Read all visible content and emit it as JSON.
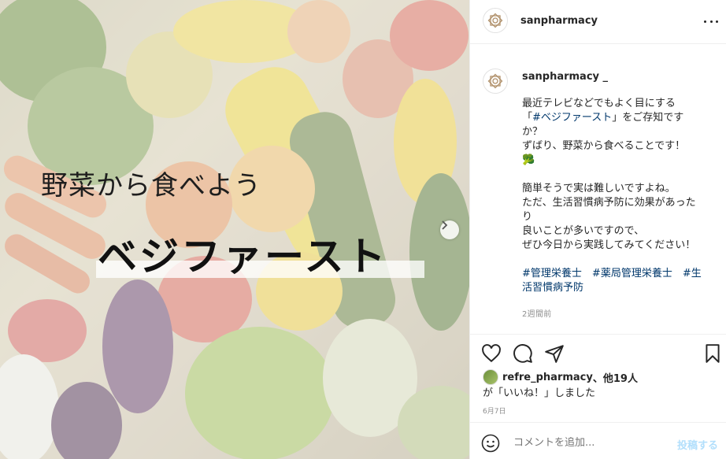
{
  "image": {
    "line1": "野菜から食べよう",
    "line2": "ベジファースト",
    "next_icon": "chevron-right-icon"
  },
  "header": {
    "username": "sanpharmacy",
    "more_icon": "more-horizontal-icon"
  },
  "caption": {
    "username": "sanpharmacy _",
    "lines": [
      "最近テレビなどでもよく目にする",
      "「#ベジファースト」をご存知です",
      "か？",
      "ずばり、野菜から食べることです！",
      "🥦",
      "",
      "簡単そうで実は難しいですよね。",
      "ただ、生活習慣病予防に効果があった",
      "り",
      "良いことが多いですので、",
      "ぜひ今日から実践してみてください！"
    ],
    "hashtag_inline": "#ベジファースト",
    "hashtags": [
      "#管理栄養士",
      "#薬局管理栄養士",
      "#生",
      "活習慣病予防"
    ],
    "timestamp": "2週間前"
  },
  "actions": {
    "like_icon": "heart-icon",
    "comment_icon": "comment-icon",
    "share_icon": "send-icon",
    "save_icon": "bookmark-icon"
  },
  "likes": {
    "user": "refre_pharmacy",
    "others": "、他19人",
    "line2": "が「いいね！」しました",
    "date": "6月7日"
  },
  "comment": {
    "placeholder": "コメントを追加...",
    "post_label": "投稿する"
  },
  "colors": {
    "link": "#00376b",
    "post_disabled": "#b2dffc",
    "muted": "#8e8e8e"
  }
}
